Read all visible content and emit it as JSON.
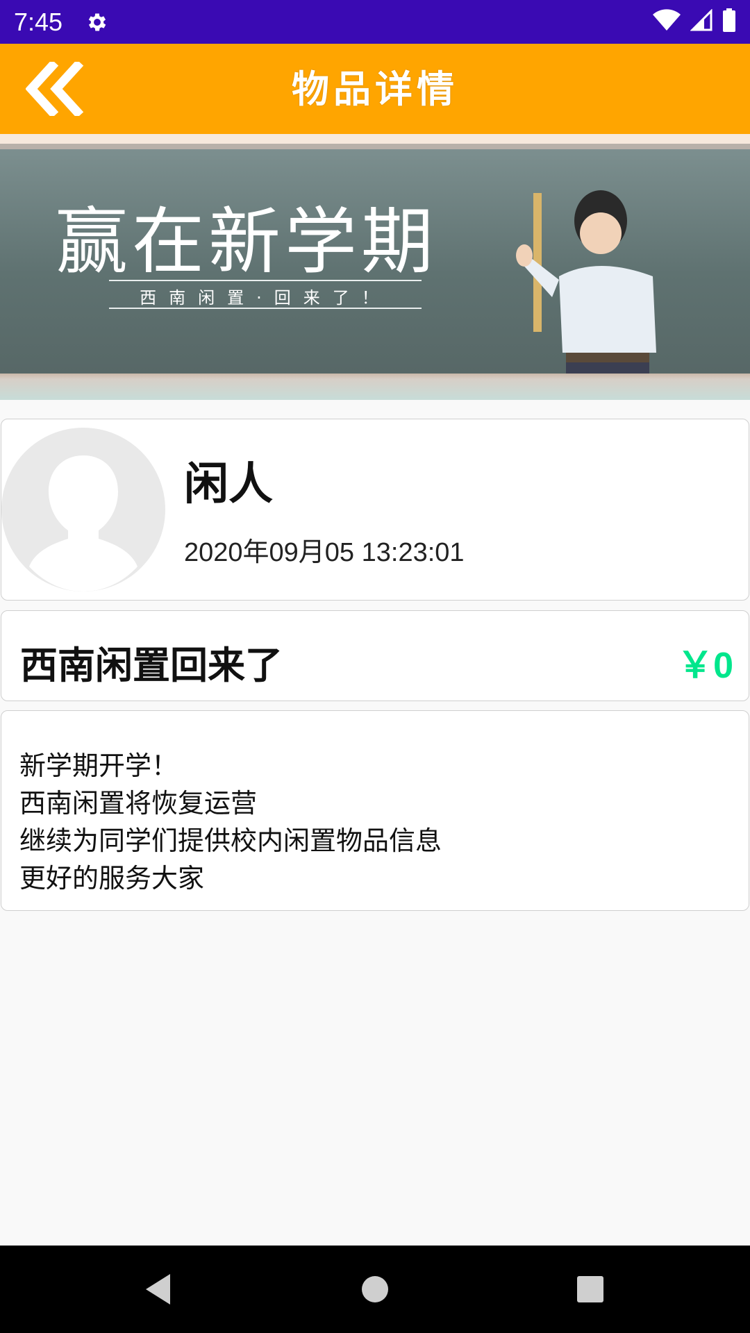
{
  "status_bar": {
    "time": "7:45",
    "icons": [
      "gear-icon",
      "wifi-icon",
      "signal-icon",
      "battery-icon"
    ]
  },
  "app_bar": {
    "title": "物品详情",
    "back_icon": "double-chevron-left-icon",
    "background": "#ffa500"
  },
  "banner": {
    "headline": "赢在新学期",
    "subline": "西南闲置·回来了！"
  },
  "seller": {
    "name": "闲人",
    "post_time": "2020年09月05 13:23:01"
  },
  "item": {
    "title": "西南闲置回来了",
    "price": "￥0",
    "price_color": "#00e68c",
    "description": [
      "新学期开学！",
      "西南闲置将恢复运营",
      "继续为同学们提供校内闲置物品信息",
      "更好的服务大家"
    ]
  },
  "nav_bar": {
    "buttons": [
      "back-triangle-icon",
      "home-circle-icon",
      "recents-square-icon"
    ]
  }
}
